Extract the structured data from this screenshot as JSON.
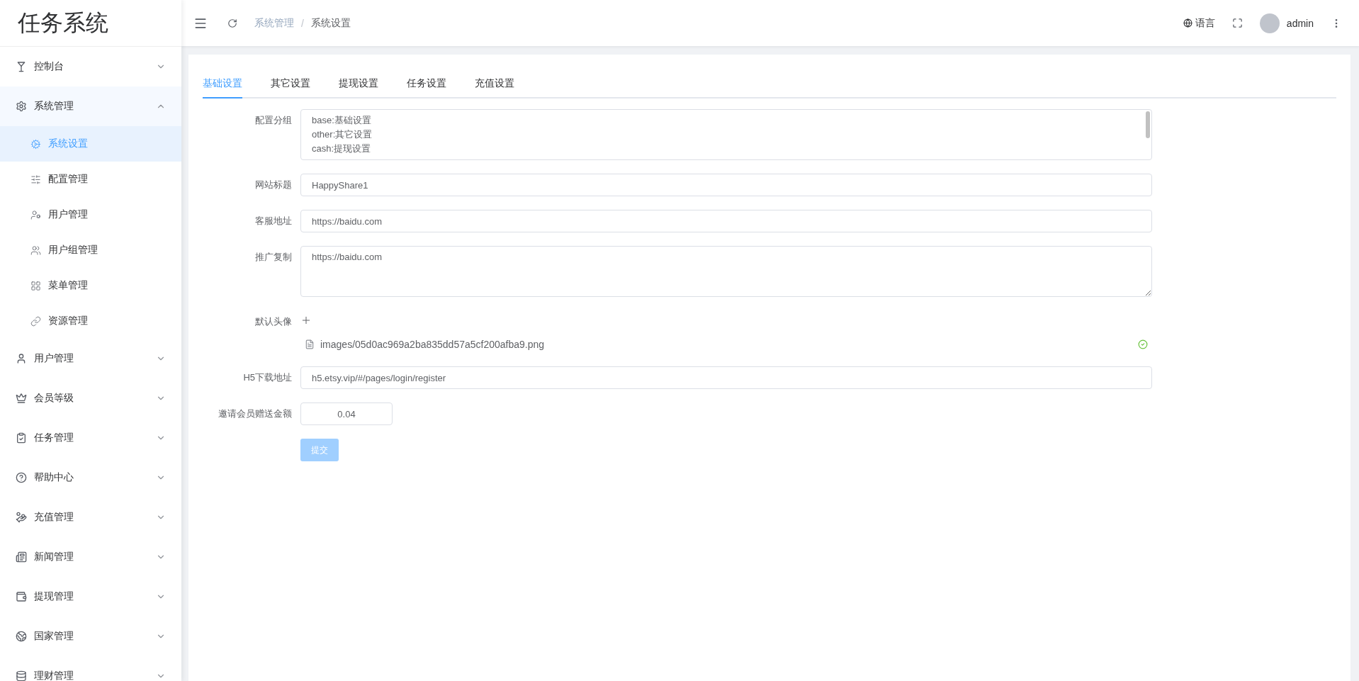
{
  "sidebar": {
    "logo": "任务系统",
    "items": [
      {
        "label": "控制台",
        "expanded": false
      },
      {
        "label": "系统管理",
        "expanded": true,
        "children": [
          {
            "label": "系统设置",
            "selected": true
          },
          {
            "label": "配置管理",
            "selected": false
          },
          {
            "label": "用户管理",
            "selected": false
          },
          {
            "label": "用户组管理",
            "selected": false
          },
          {
            "label": "菜单管理",
            "selected": false
          },
          {
            "label": "资源管理",
            "selected": false
          }
        ]
      },
      {
        "label": "用户管理",
        "expanded": false
      },
      {
        "label": "会员等级",
        "expanded": false
      },
      {
        "label": "任务管理",
        "expanded": false
      },
      {
        "label": "帮助中心",
        "expanded": false
      },
      {
        "label": "充值管理",
        "expanded": false
      },
      {
        "label": "新闻管理",
        "expanded": false
      },
      {
        "label": "提现管理",
        "expanded": false
      },
      {
        "label": "国家管理",
        "expanded": false
      },
      {
        "label": "理财管理",
        "expanded": false
      }
    ]
  },
  "header": {
    "breadcrumb": [
      "系统管理",
      "系统设置"
    ],
    "breadcrumb_separator": "/",
    "language": "语言",
    "user": "admin"
  },
  "tabs": [
    {
      "label": "基础设置",
      "selected": true
    },
    {
      "label": "其它设置",
      "selected": false
    },
    {
      "label": "提现设置",
      "selected": false
    },
    {
      "label": "任务设置",
      "selected": false
    },
    {
      "label": "充值设置",
      "selected": false
    }
  ],
  "form": {
    "fields": [
      {
        "label": "配置分组",
        "kind": "lines",
        "lines": [
          "base:基础设置",
          "other:其它设置",
          "cash:提现设置"
        ]
      },
      {
        "label": "网站标题",
        "kind": "input",
        "value": "HappyShare1"
      },
      {
        "label": "客服地址",
        "kind": "input",
        "value": "https://baidu.com"
      },
      {
        "label": "推广复制",
        "kind": "textarea",
        "value": "https://baidu.com"
      },
      {
        "label": "默认头像",
        "kind": "upload",
        "file": "images/05d0ac969a2ba835dd57a5cf200afba9.png"
      },
      {
        "label": "H5下载地址",
        "kind": "input",
        "value": "h5.etsy.vip/#/pages/login/register"
      },
      {
        "label": "邀请会员赠送金额",
        "kind": "number",
        "value": "0.04"
      }
    ],
    "submit": {
      "label": "提交",
      "disabled": true
    }
  }
}
